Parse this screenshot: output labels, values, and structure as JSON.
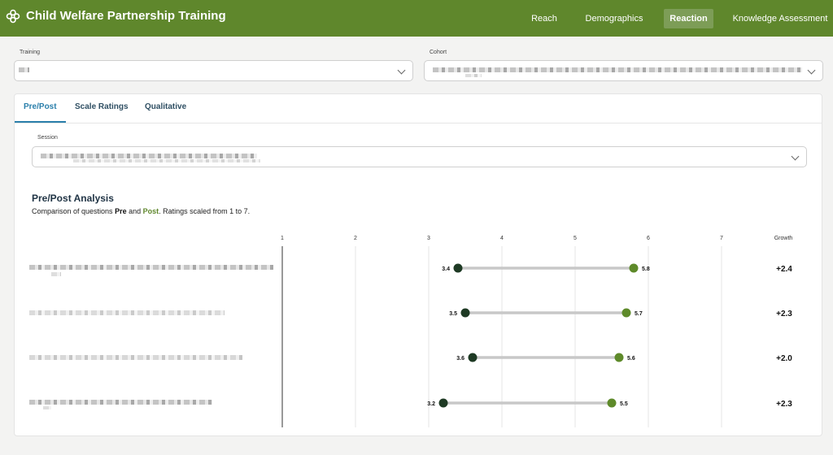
{
  "app": {
    "title": "Child Welfare Partnership Training"
  },
  "nav": [
    {
      "label": "Reach",
      "active": false
    },
    {
      "label": "Demographics",
      "active": false
    },
    {
      "label": "Reaction",
      "active": true
    },
    {
      "label": "Knowledge Assessment",
      "active": false
    }
  ],
  "filters": {
    "training_label": "Training",
    "cohort_label": "Cohort",
    "session_label": "Session"
  },
  "tabs": [
    {
      "label": "Pre/Post",
      "active": true
    },
    {
      "label": "Scale Ratings",
      "active": false
    },
    {
      "label": "Qualitative",
      "active": false
    }
  ],
  "analysis": {
    "title": "Pre/Post Analysis",
    "subtitle_prefix": "Comparison of questions ",
    "pre_word": "Pre",
    "and_word": " and ",
    "post_word": "Post",
    "subtitle_suffix": ". Ratings scaled from 1 to 7."
  },
  "colors": {
    "header": "#5f872c",
    "pre_dot": "#1e3a24",
    "post_dot": "#5e8a2a",
    "bar": "#c8c8c8"
  },
  "chart_data": {
    "type": "dumbbell",
    "x_ticks": [
      "1",
      "2",
      "3",
      "4",
      "5",
      "6",
      "7"
    ],
    "xlim": [
      1,
      7
    ],
    "growth_header": "Growth",
    "rows": [
      {
        "pre": 3.4,
        "post": 5.8,
        "pre_label": "3.4",
        "post_label": "5.8",
        "growth": "+2.4"
      },
      {
        "pre": 3.5,
        "post": 5.7,
        "pre_label": "3.5",
        "post_label": "5.7",
        "growth": "+2.3"
      },
      {
        "pre": 3.6,
        "post": 5.6,
        "pre_label": "3.6",
        "post_label": "5.6",
        "growth": "+2.0"
      },
      {
        "pre": 3.2,
        "post": 5.5,
        "pre_label": "3.2",
        "post_label": "5.5",
        "growth": "+2.3"
      }
    ]
  }
}
